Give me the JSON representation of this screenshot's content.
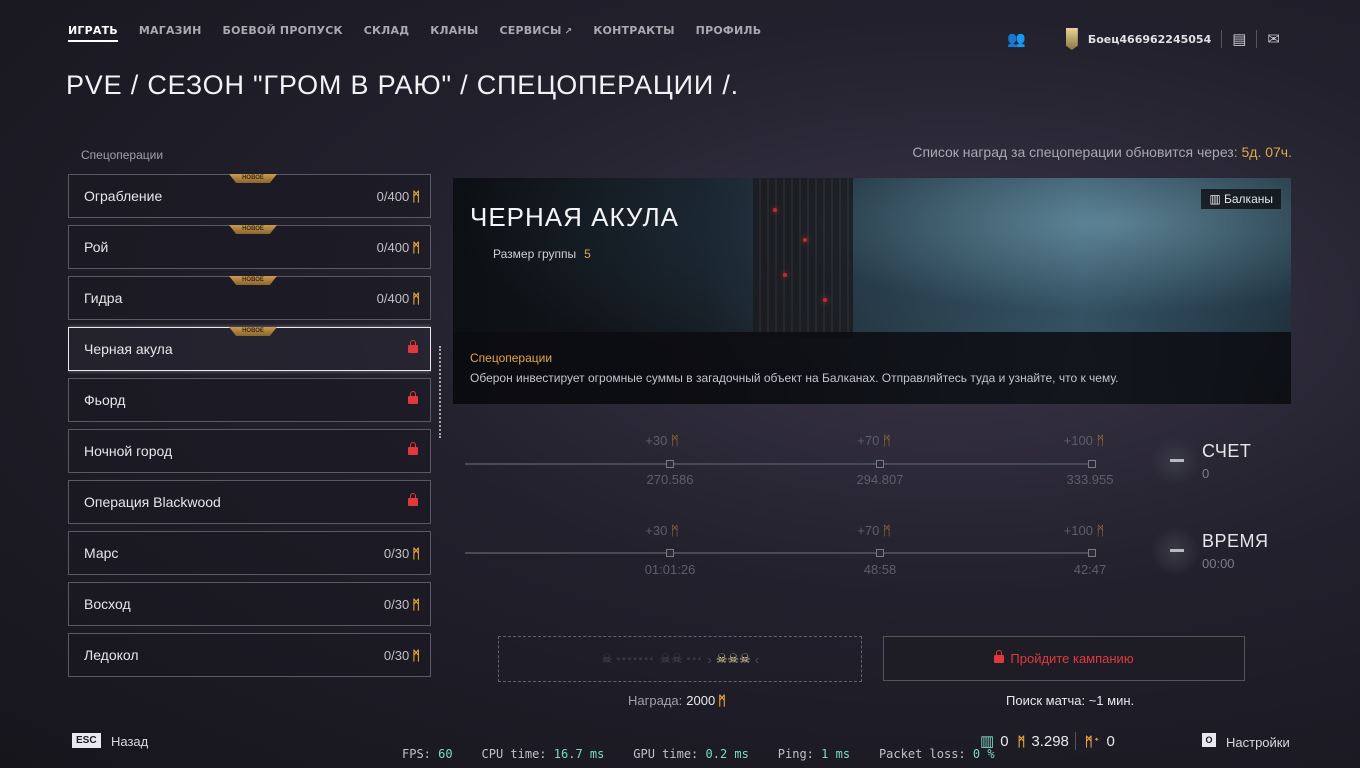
{
  "nav": {
    "items": [
      "ИГРАТЬ",
      "МАГАЗИН",
      "БОЕВОЙ ПРОПУСК",
      "СКЛАД",
      "КЛАНЫ",
      "СЕРВИСЫ",
      "КОНТРАКТЫ",
      "ПРОФИЛЬ"
    ],
    "active_index": 0,
    "username": "Боец466962245054"
  },
  "breadcrumb": "PVE / СЕЗОН \"ГРОМ В РАЮ\" / СПЕЦОПЕРАЦИИ /.",
  "sidebar": {
    "title": "Спецоперации",
    "new_badge": "НОВОЕ",
    "items": [
      {
        "label": "Ограбление",
        "progress": "0/400",
        "is_new": true,
        "locked": false
      },
      {
        "label": "Рой",
        "progress": "0/400",
        "is_new": true,
        "locked": false
      },
      {
        "label": "Гидра",
        "progress": "0/400",
        "is_new": true,
        "locked": false
      },
      {
        "label": "Черная акула",
        "progress": "",
        "is_new": true,
        "locked": true,
        "selected": true
      },
      {
        "label": "Фьорд",
        "progress": "",
        "is_new": false,
        "locked": true
      },
      {
        "label": "Ночной город",
        "progress": "",
        "is_new": false,
        "locked": true
      },
      {
        "label": "Операция Blackwood",
        "progress": "",
        "is_new": false,
        "locked": true
      },
      {
        "label": "Марс",
        "progress": "0/30",
        "is_new": false,
        "locked": false
      },
      {
        "label": "Восход",
        "progress": "0/30",
        "is_new": false,
        "locked": false
      },
      {
        "label": "Ледокол",
        "progress": "0/30",
        "is_new": false,
        "locked": false
      }
    ]
  },
  "refresh": {
    "text": "Список наград за спецоперации обновится через:",
    "time": "5д. 07ч."
  },
  "mission": {
    "title": "ЧЕРНАЯ АКУЛА",
    "group_label": "Размер группы",
    "group_size": "5",
    "map": "Балканы",
    "category": "Спецоперации",
    "description": "Оберон инвестирует огромные суммы в загадочный объект на Балканах. Отправляйтесь туда и узнайте, что к чему."
  },
  "score_track": {
    "bonuses": [
      "+30",
      "+70",
      "+100"
    ],
    "thresholds": [
      "270.586",
      "294.807",
      "333.955"
    ],
    "label": "СЧЕТ",
    "value": "0"
  },
  "time_track": {
    "bonuses": [
      "+30",
      "+70",
      "+100"
    ],
    "thresholds": [
      "01:01:26",
      "48:58",
      "42:47"
    ],
    "label": "ВРЕМЯ",
    "value": "00:00"
  },
  "reward": {
    "label": "Награда:",
    "value": "2000"
  },
  "campaign_button": "Пройдите кампанию",
  "search": "Поиск матча: ~1 мин.",
  "bottom": {
    "esc": "ESC",
    "back": "Назад",
    "fps_label": "FPS:",
    "fps": "60",
    "cpu_label": "CPU time:",
    "cpu": "16.7 ms",
    "gpu_label": "GPU time:",
    "gpu": "0.2 ms",
    "ping_label": "Ping:",
    "ping": "1 ms",
    "loss_label": "Packet loss:",
    "loss": "0 %",
    "currency1": "0",
    "currency2": "3.298",
    "currency3": "0",
    "settings_key": "O",
    "settings": "Настройки"
  },
  "colors": {
    "accent_gold": "#e0a848",
    "lock_red": "#e0393d"
  }
}
